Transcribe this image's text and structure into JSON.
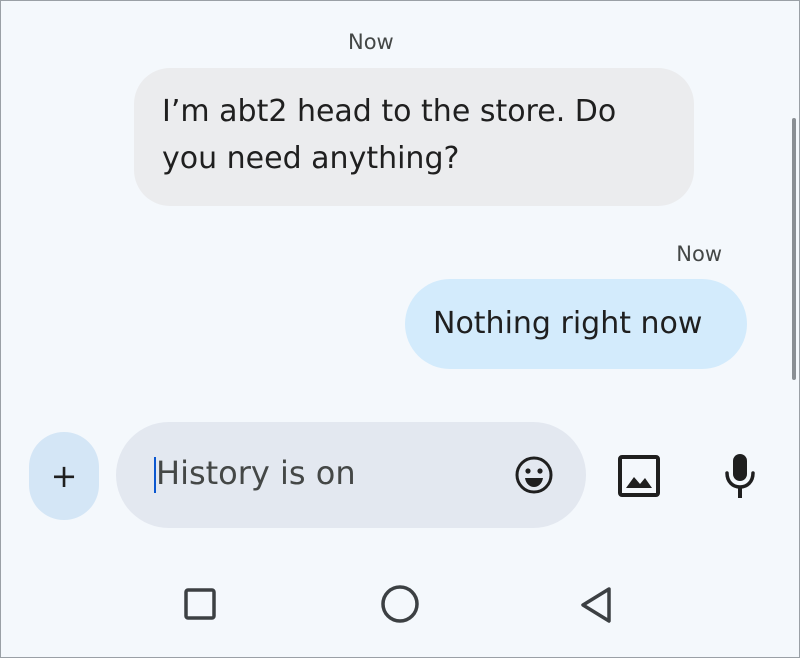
{
  "conversation": {
    "messages": [
      {
        "direction": "incoming",
        "timestamp": "Now",
        "text_line1": "I’m abt2 head to the store. Do",
        "text_line2": "you need anything?"
      },
      {
        "direction": "outgoing",
        "timestamp": "Now",
        "text": "Nothing right now"
      }
    ]
  },
  "composer": {
    "placeholder": "History is on",
    "add_label": "+",
    "icons": [
      "emoji-icon",
      "gallery-icon",
      "microphone-icon"
    ]
  },
  "navigation_bar": {
    "icons": [
      "recents-icon",
      "home-icon",
      "back-icon"
    ]
  },
  "colors": {
    "background": "#f4f8fc",
    "incoming_bubble": "#ebecee",
    "outgoing_bubble": "#d3ebfc",
    "compose_field": "#e3e8f0",
    "add_button": "#d4e6f6"
  }
}
